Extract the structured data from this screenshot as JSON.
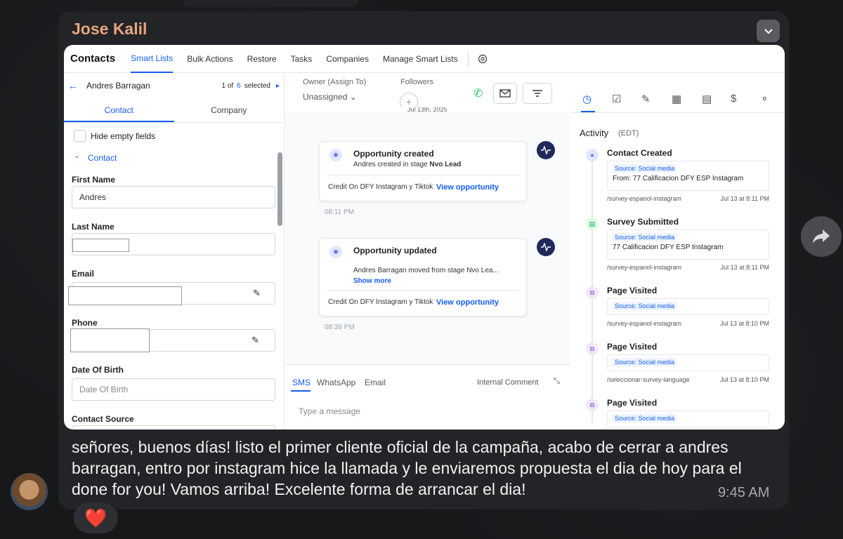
{
  "message": {
    "sender": "Jose Kalil",
    "text": "señores, buenos días! listo el primer cliente oficial de la campaña, acabo de cerrar a andres barragan, entro por instagram hice la llamada y le enviaremos propuesta el dia de hoy para el done for you! Vamos arriba! Excelente forma de arrancar el dia!",
    "time": "9:45 AM",
    "reaction": "❤️"
  },
  "app": {
    "title": "Contacts",
    "nav": [
      "Smart Lists",
      "Bulk Actions",
      "Restore",
      "Tasks",
      "Companies",
      "Manage Smart Lists"
    ],
    "active_nav": "Smart Lists",
    "contact_name": "Andres Barragan",
    "pager": {
      "current": "1 of",
      "count": "6",
      "suffix": "selected"
    },
    "tabs": [
      "Contact",
      "Company"
    ],
    "hide_empty": "Hide empty fields",
    "section": "Contact",
    "fields": {
      "first_name_label": "First Name",
      "first_name": "Andres",
      "last_name_label": "Last Name",
      "email_label": "Email",
      "phone_label": "Phone",
      "dob_label": "Date Of Birth",
      "dob_placeholder": "Date Of Birth",
      "source_label": "Contact Source"
    },
    "owner_label": "Owner (Assign To)",
    "owner_value": "Unassigned",
    "followers_label": "Followers",
    "date_chip": "Jul 13th, 2025",
    "cards": [
      {
        "title": "Opportunity created",
        "sub": "Andres created in stage",
        "stage": "Nvo Lead",
        "credit": "Credit On DFY Instagram y Tiktok (Calif...",
        "link": "View opportunity",
        "time": "08:11 PM"
      },
      {
        "title": "Opportunity updated",
        "sub": "Andres Barragan moved from stage Nvo Lea...",
        "more": "Show more",
        "credit": "Credit On DFY Instagram y Tiktok (Calif...",
        "link": "View opportunity",
        "time": "08:38 PM"
      }
    ],
    "composer": {
      "tabs": [
        "SMS",
        "WhatsApp",
        "Email"
      ],
      "internal": "Internal Comment",
      "placeholder": "Type a message"
    },
    "activity_title": "Activity",
    "activity_tz": "(EDT)",
    "activity": [
      {
        "title": "Contact Created",
        "source": "Source: Social media",
        "detail": "From: 77 Calificacion DFY ESP Instagram",
        "path": "/survey-espanol-instagram",
        "when": "Jul 13 at 8:11 PM"
      },
      {
        "title": "Survey Submitted",
        "source": "Source: Social media",
        "detail": "77 Calificacion DFY ESP Instagram",
        "path": "/survey-espanol-instagram",
        "when": "Jul 13 at 8:11 PM"
      },
      {
        "title": "Page Visited",
        "source": "Source: Social media",
        "detail": "",
        "path": "/survey-espanol-instagram",
        "when": "Jul 13 at 8:10 PM"
      },
      {
        "title": "Page Visited",
        "source": "Source: Social media",
        "detail": "",
        "path": "/seleccionar-survey-language",
        "when": "Jul 13 at 8:10 PM"
      },
      {
        "title": "Page Visited",
        "source": "Source: Social media",
        "detail": "",
        "path": "",
        "when": ""
      }
    ]
  },
  "icons": [
    "chevron-down-icon",
    "share-icon",
    "gear-icon",
    "phone-icon",
    "mail-icon",
    "filter-icon",
    "pencil-icon",
    "clock-icon",
    "check-icon",
    "calendar-icon",
    "document-icon",
    "dollar-icon",
    "nodes-icon"
  ],
  "colors": {
    "accent": "#155eef",
    "sender": "#e8a57e",
    "bubble": "#232427"
  }
}
